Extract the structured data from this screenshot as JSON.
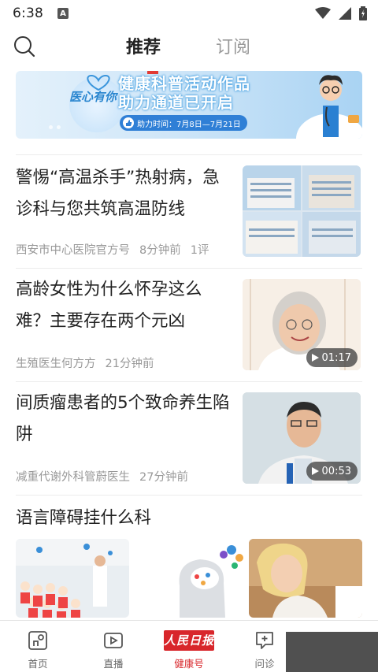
{
  "status": {
    "time": "6:38",
    "notif": "A"
  },
  "header": {
    "tabs": [
      {
        "label": "推荐"
      },
      {
        "label": "订阅"
      }
    ]
  },
  "banner": {
    "logo_text": "医心有你",
    "title_line1": "健康科普活动作品",
    "title_line2": "助力通道已开启",
    "time_label": "助力时间：7月8日—7月21日"
  },
  "articles": [
    {
      "title": "警惕“高温杀手”热射病，急诊科与您共筑高温防线",
      "source": "西安市中心医院官方号",
      "time": "8分钟前",
      "comments": "1评"
    },
    {
      "title": "高龄女性为什么怀孕这么难？主要存在两个元凶",
      "source": "生殖医生何方方",
      "time": "21分钟前",
      "duration": "01:17"
    },
    {
      "title": "间质瘤患者的5个致命养生陷阱",
      "source": "减重代谢外科管蔚医生",
      "time": "27分钟前",
      "duration": "00:53"
    },
    {
      "title": "语言障碍挂什么科"
    }
  ],
  "bottom_nav": [
    {
      "label": "首页",
      "icon": "home-icon"
    },
    {
      "label": "直播",
      "icon": "live-icon"
    },
    {
      "label": "健康号",
      "brand": "人民日报",
      "icon": "brand-logo"
    },
    {
      "label": "问诊",
      "icon": "consult-icon"
    }
  ],
  "colors": {
    "accent": "#d8262b",
    "banner_blue": "#2f7fd6",
    "meta_gray": "#999999"
  }
}
